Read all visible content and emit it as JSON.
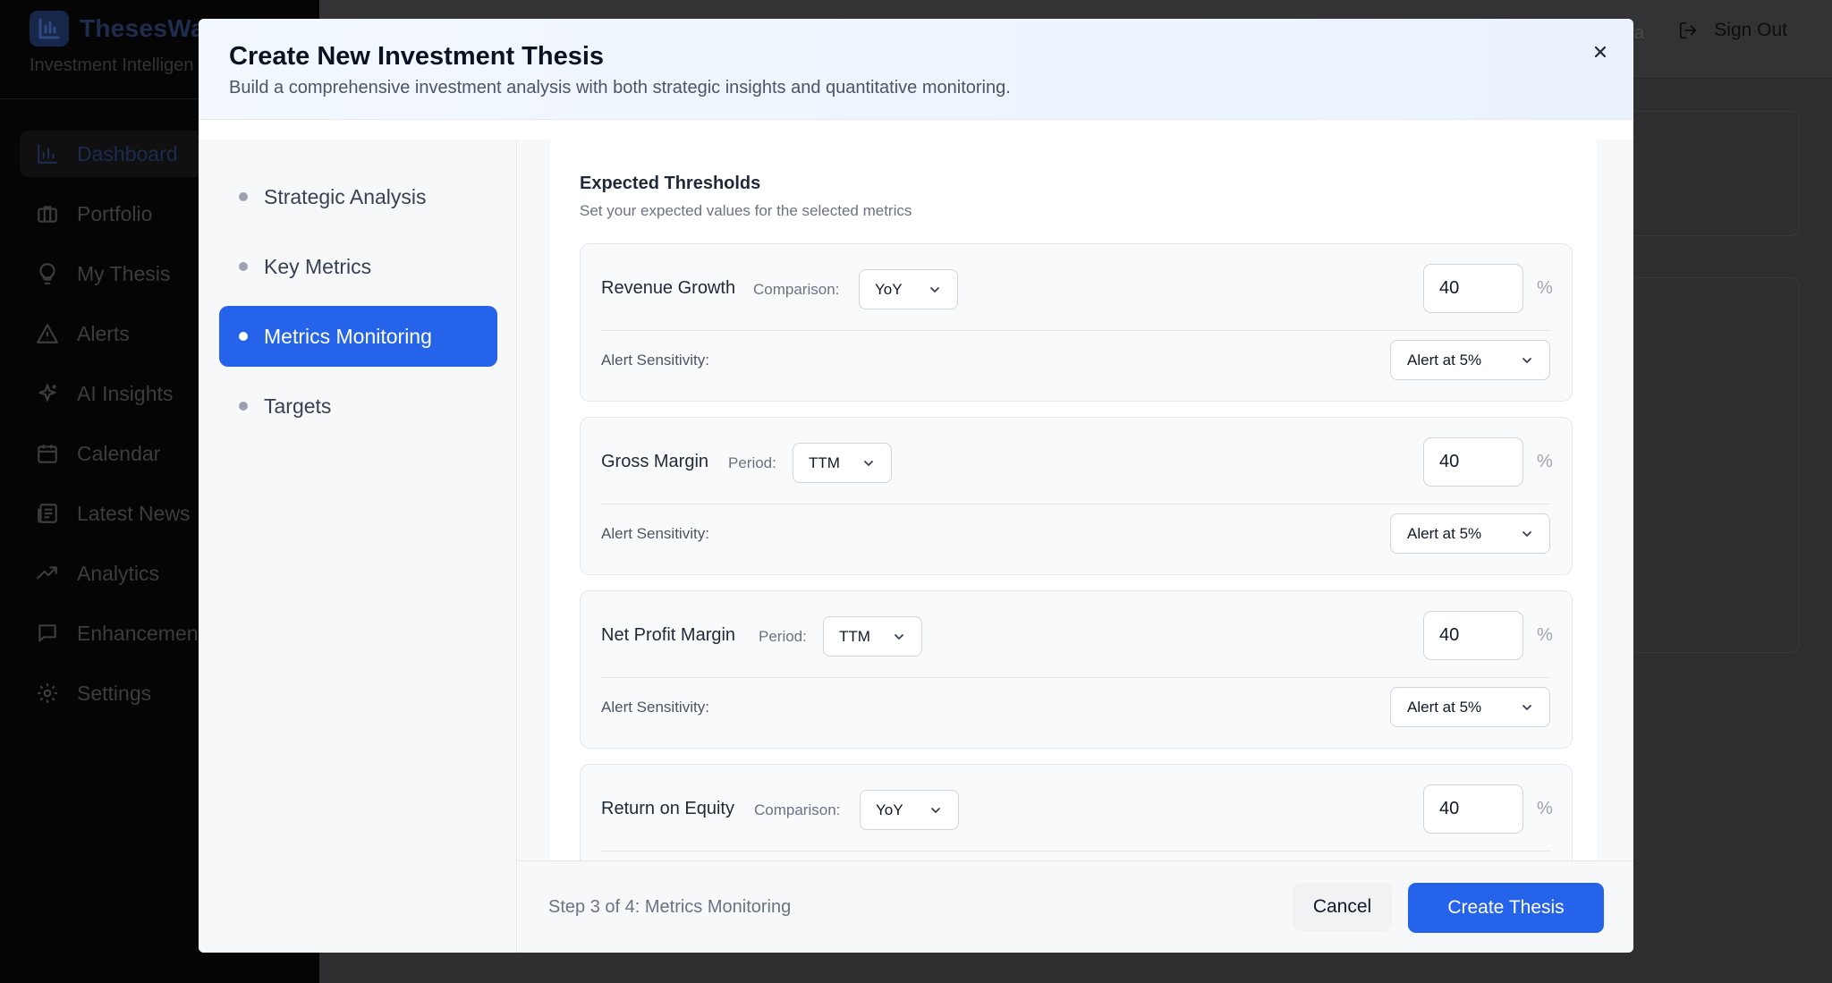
{
  "app": {
    "name": "ThesesWa",
    "tagline": "Investment Intelligen",
    "user_fragment": "a",
    "sign_out_label": "Sign Out"
  },
  "sidebar": {
    "items": [
      {
        "label": "Dashboard",
        "icon": "bar-chart-icon"
      },
      {
        "label": "Portfolio",
        "icon": "briefcase-icon"
      },
      {
        "label": "My Thesis",
        "icon": "lightbulb-icon"
      },
      {
        "label": "Alerts",
        "icon": "warning-icon"
      },
      {
        "label": "AI Insights",
        "icon": "sparkles-icon"
      },
      {
        "label": "Calendar",
        "icon": "calendar-icon"
      },
      {
        "label": "Latest News",
        "icon": "newspaper-icon"
      },
      {
        "label": "Analytics",
        "icon": "trending-up-icon"
      },
      {
        "label": "Enhancemen",
        "icon": "message-square-icon"
      },
      {
        "label": "Settings",
        "icon": "gear-icon"
      }
    ]
  },
  "modal": {
    "title": "Create New Investment Thesis",
    "subtitle": "Build a comprehensive investment analysis with both strategic insights and quantitative monitoring.",
    "steps": [
      {
        "label": "Strategic Analysis"
      },
      {
        "label": "Key Metrics"
      },
      {
        "label": "Metrics Monitoring"
      },
      {
        "label": "Targets"
      }
    ],
    "section_title": "Expected Thresholds",
    "section_subtitle": "Set your expected values for the selected metrics",
    "sensitivity_label": "Alert Sensitivity:",
    "unit": "%",
    "metrics": [
      {
        "name": "Revenue Growth",
        "compare_label": "Comparison:",
        "compare_value": "YoY",
        "value": "40",
        "alert": "Alert at 5%"
      },
      {
        "name": "Gross Margin",
        "compare_label": "Period:",
        "compare_value": "TTM",
        "value": "40",
        "alert": "Alert at 5%"
      },
      {
        "name": "Net Profit Margin",
        "compare_label": "Period:",
        "compare_value": "TTM",
        "value": "40",
        "alert": "Alert at 5%"
      },
      {
        "name": "Return on Equity",
        "compare_label": "Comparison:",
        "compare_value": "YoY",
        "value": "40",
        "alert": "Alert at 5%"
      }
    ],
    "footer": {
      "step_info": "Step 3 of 4: Metrics Monitoring",
      "cancel_label": "Cancel",
      "create_label": "Create Thesis"
    }
  },
  "colors": {
    "accent": "#2563eb",
    "overlay": "#2f2f31"
  }
}
